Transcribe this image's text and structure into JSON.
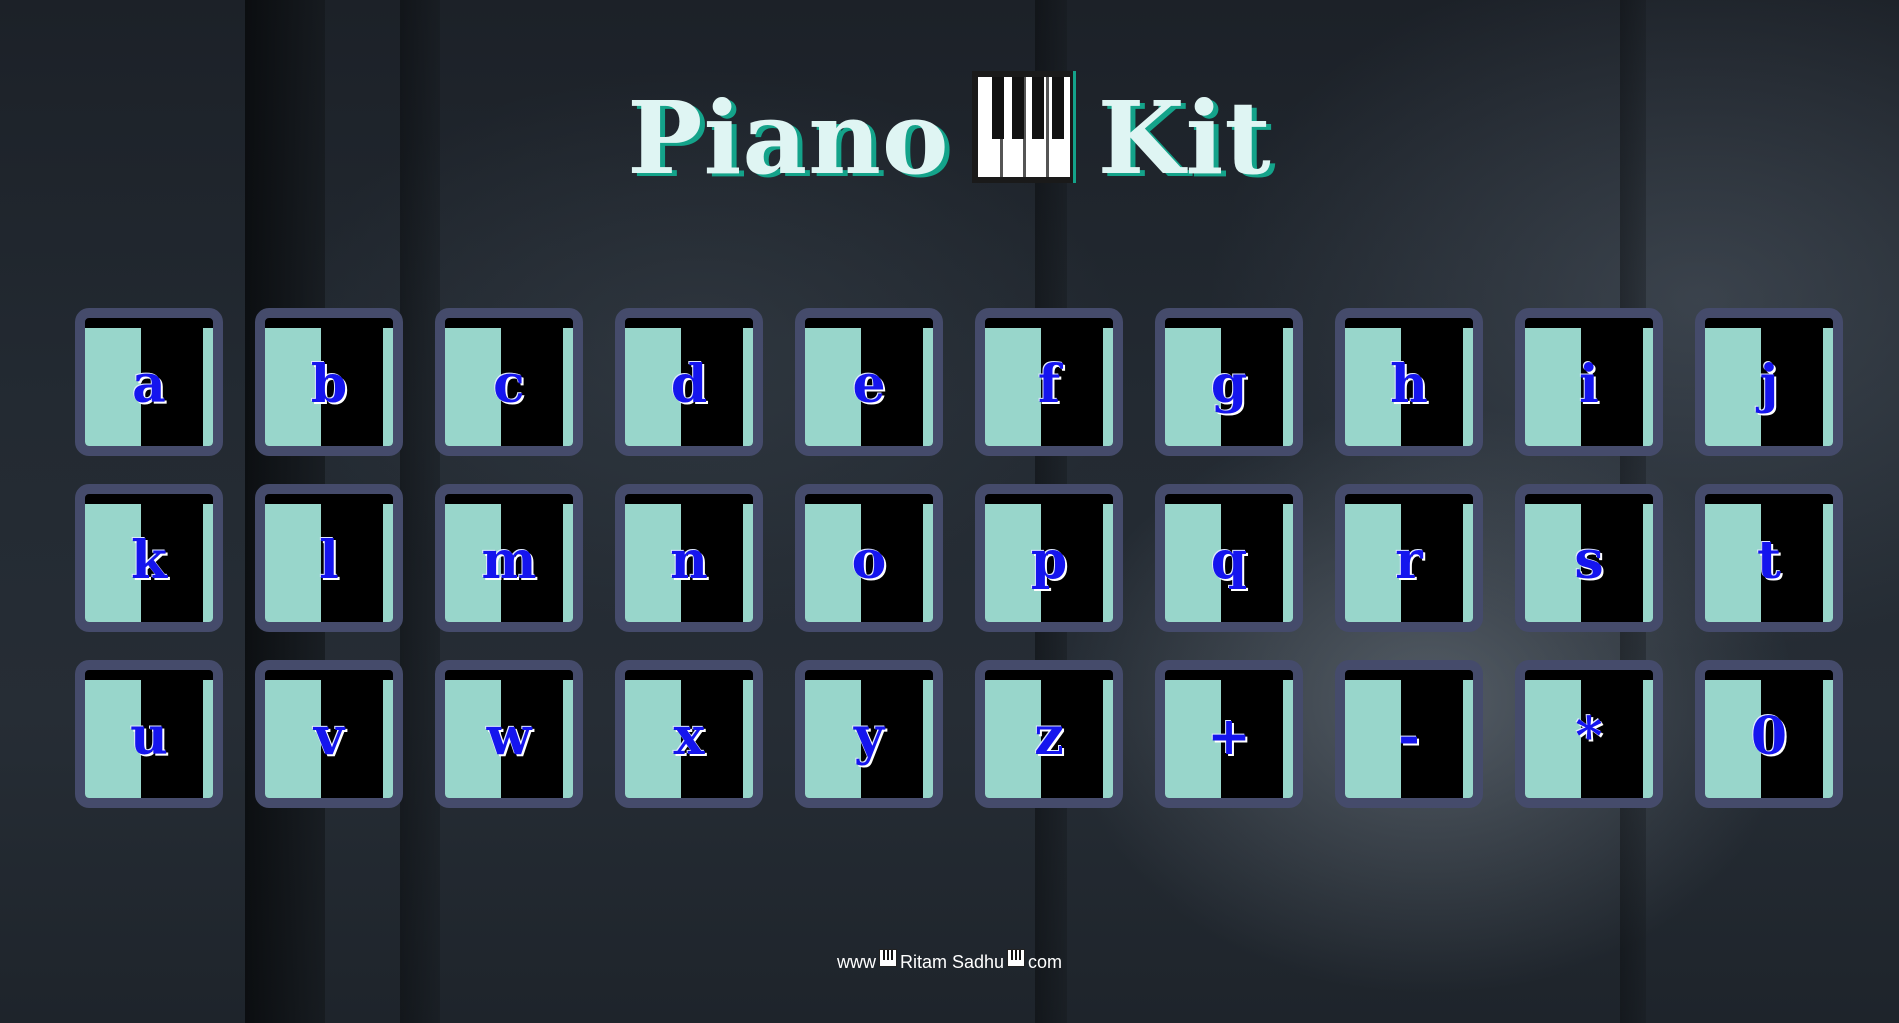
{
  "title": {
    "word1": "Piano",
    "word2": "Kit",
    "icon": "piano-keys-icon"
  },
  "keys": [
    {
      "label": "a"
    },
    {
      "label": "b"
    },
    {
      "label": "c"
    },
    {
      "label": "d"
    },
    {
      "label": "e"
    },
    {
      "label": "f"
    },
    {
      "label": "g"
    },
    {
      "label": "h"
    },
    {
      "label": "i"
    },
    {
      "label": "j"
    },
    {
      "label": "k"
    },
    {
      "label": "l"
    },
    {
      "label": "m"
    },
    {
      "label": "n"
    },
    {
      "label": "o"
    },
    {
      "label": "p"
    },
    {
      "label": "q"
    },
    {
      "label": "r"
    },
    {
      "label": "s"
    },
    {
      "label": "t"
    },
    {
      "label": "u"
    },
    {
      "label": "v"
    },
    {
      "label": "w"
    },
    {
      "label": "x"
    },
    {
      "label": "y"
    },
    {
      "label": "z"
    },
    {
      "label": "+"
    },
    {
      "label": "-"
    },
    {
      "label": "*"
    },
    {
      "label": "0"
    }
  ],
  "footer": {
    "prefix": "www",
    "name": "Ritam Sadhu",
    "suffix": "com",
    "icon": "piano-keys-icon"
  },
  "colors": {
    "title_text": "#dff5f3",
    "title_shadow": "#14a38a",
    "key_border": "#454b6b",
    "key_white": "#98d6cb",
    "key_black": "#000000",
    "key_label": "#1515ee"
  }
}
